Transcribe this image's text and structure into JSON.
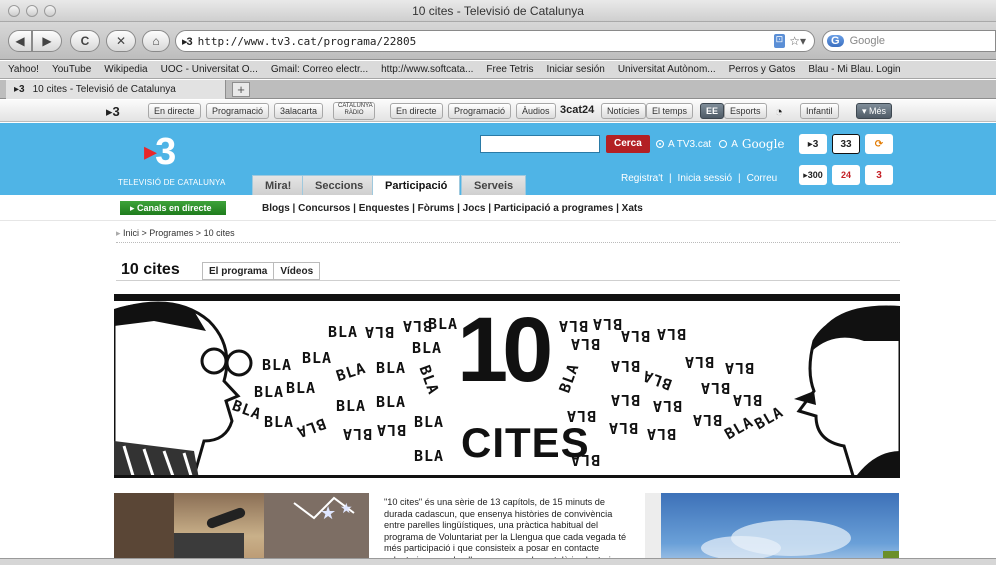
{
  "window": {
    "title": "10 cites - Televisió de Catalunya"
  },
  "toolbar": {
    "back": "◀",
    "forward": "▶",
    "reload": "C",
    "stop": "✕",
    "home": "⌂",
    "url_favicon": "▸3",
    "url": "http://www.tv3.cat/programa/22805",
    "rss_icon": "rss-icon",
    "star_icon": "star-icon",
    "search_engine": "G",
    "search_placeholder": "Google"
  },
  "bookmarks": [
    "Yahoo!",
    "YouTube",
    "Wikipedia",
    "UOC - Universitat O...",
    "Gmail: Correo electr...",
    "http://www.softcata...",
    "Free Tetris",
    "Iniciar sesión",
    "Universitat Autònom...",
    "Perros y Gatos",
    "Blau - Mi Blau. Login"
  ],
  "browser_tab": {
    "favicon": "▸3",
    "label": "10 cites - Televisió de Catalunya",
    "add": "+"
  },
  "network_bar": {
    "logo_tv3": "▸3",
    "items": [
      "En directe",
      "Programació",
      "3alacarta"
    ],
    "radio_logo": "CATALUNYA RÀDIO",
    "radio_items": [
      "En directe",
      "Programació",
      "Àudios"
    ],
    "logo_3cat24": "3cat24",
    "news_items": [
      "Notícies",
      "El temps"
    ],
    "ee_logo": "EE",
    "esports": "Esports",
    "infantil": "Infantil",
    "mes": "Més"
  },
  "header": {
    "brand": "3",
    "brand_sub": "TELEVISIÓ DE CATALUNYA",
    "search_button": "Cerca",
    "option_tv3": "A TV3.cat",
    "option_google_prefix": "A",
    "option_google": "Google",
    "tabs": [
      "Mira!",
      "Seccions",
      "Participació",
      "Serveis"
    ],
    "active_tab": "Participació",
    "links": [
      "Registra't",
      "|",
      "Inicia sessió",
      "|",
      "Correu"
    ],
    "channels_top": [
      "▸3",
      "33",
      "⟳"
    ],
    "channels_bottom": [
      "▸300",
      "24",
      "3"
    ]
  },
  "subnav": {
    "live_button": "Canals en directe",
    "links": "Blogs | Concursos | Enquestes | Fòrums | Jocs | Participació a programes | Xats"
  },
  "breadcrumb": {
    "text": "Inici  >  Programes  >  10 cites"
  },
  "program": {
    "title": "10 cites",
    "tabs": [
      "El programa",
      "Vídeos"
    ]
  },
  "banner": {
    "number": "10",
    "word": "CITES",
    "bla": "BLA"
  },
  "description": "\"10 cites\" és una sèrie de 13 capítols, de 15 minuts de durada cadascun, que ensenya històries de convivència entre parelles lingüístiques, una pràctica habitual del programa de Voluntariat per la Llengua que cada vegada té més participació i que consisteix a posar en contacte voluntaris que volen llançar-se a parlar català i voluntaris"
}
